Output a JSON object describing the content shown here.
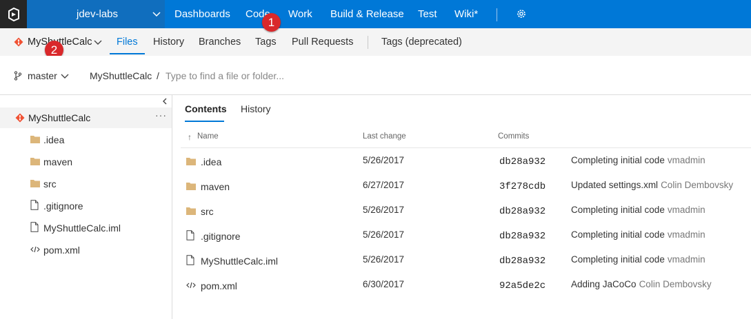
{
  "top_nav": {
    "project": "jdev-labs",
    "items": [
      "Dashboards",
      "Code",
      "Work",
      "Build & Release",
      "Test",
      "Wiki*"
    ]
  },
  "sub_nav": {
    "repo": "MyShuttleCalc",
    "items": [
      "Files",
      "History",
      "Branches",
      "Tags",
      "Pull Requests"
    ],
    "deprecated_tags": "Tags (deprecated)"
  },
  "badges": [
    "1",
    "2"
  ],
  "branch_bar": {
    "branch": "master",
    "crumb": "MyShuttleCalc",
    "slash": "/",
    "placeholder": "Type to find a file or folder..."
  },
  "tree": {
    "root": "MyShuttleCalc",
    "more": "···",
    "items": [
      {
        "label": ".idea",
        "icon": "folder-icon"
      },
      {
        "label": "maven",
        "icon": "folder-icon"
      },
      {
        "label": "src",
        "icon": "folder-icon"
      },
      {
        "label": ".gitignore",
        "icon": "file-icon"
      },
      {
        "label": "MyShuttleCalc.iml",
        "icon": "file-icon"
      },
      {
        "label": "pom.xml",
        "icon": "code-file-icon"
      }
    ]
  },
  "content": {
    "tabs": [
      "Contents",
      "History"
    ],
    "columns": {
      "name": "Name",
      "last_change": "Last change",
      "commits": "Commits"
    },
    "sort_glyph": "↑",
    "rows": [
      {
        "name": ".idea",
        "icon": "folder-icon",
        "date": "5/26/2017",
        "commit": "db28a932",
        "message": "Completing initial code",
        "author": "vmadmin"
      },
      {
        "name": "maven",
        "icon": "folder-icon",
        "date": "6/27/2017",
        "commit": "3f278cdb",
        "message": "Updated settings.xml",
        "author": "Colin Dembovsky"
      },
      {
        "name": "src",
        "icon": "folder-icon",
        "date": "5/26/2017",
        "commit": "db28a932",
        "message": "Completing initial code",
        "author": "vmadmin"
      },
      {
        "name": ".gitignore",
        "icon": "file-icon",
        "date": "5/26/2017",
        "commit": "db28a932",
        "message": "Completing initial code",
        "author": "vmadmin"
      },
      {
        "name": "MyShuttleCalc.iml",
        "icon": "file-icon",
        "date": "5/26/2017",
        "commit": "db28a932",
        "message": "Completing initial code",
        "author": "vmadmin"
      },
      {
        "name": "pom.xml",
        "icon": "code-file-icon",
        "date": "6/30/2017",
        "commit": "92a5de2c",
        "message": "Adding JaCoCo",
        "author": "Colin Dembovsky"
      }
    ]
  },
  "colors": {
    "accent": "#0078d7",
    "project_bg": "#106ebe",
    "logo_bg": "#262626",
    "badge": "#d9282b",
    "git": "#f05133",
    "folder": "#dcb67a"
  }
}
